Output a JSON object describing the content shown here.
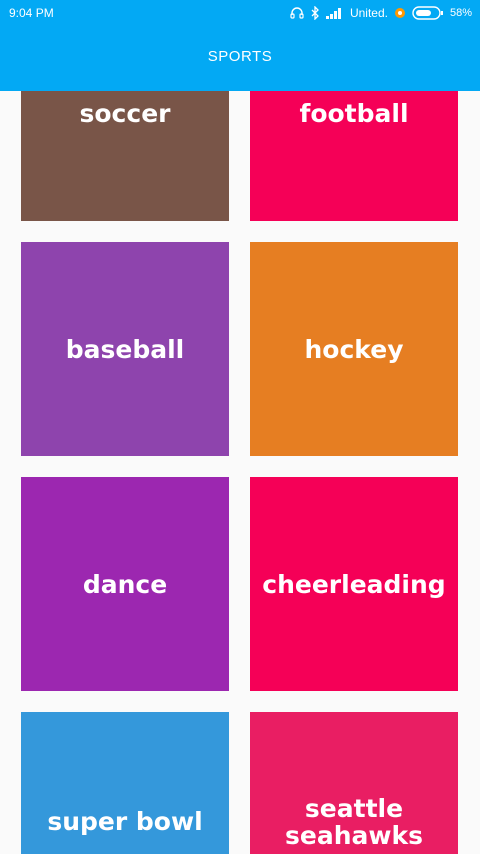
{
  "status_bar": {
    "time": "9:04 PM",
    "carrier": "United.",
    "battery": "58%"
  },
  "header": {
    "title": "SPORTS"
  },
  "tiles": [
    {
      "label": "soccer",
      "color": "#795548"
    },
    {
      "label": "football",
      "color": "#f50057"
    },
    {
      "label": "baseball",
      "color": "#8e44ad"
    },
    {
      "label": "hockey",
      "color": "#e67e22"
    },
    {
      "label": "dance",
      "color": "#9c27b0"
    },
    {
      "label": "cheerleading",
      "color": "#f50057"
    },
    {
      "label": "super bowl",
      "color": "#3498db"
    },
    {
      "label": "seattle seahawks",
      "color": "#e91e63"
    }
  ],
  "colors": {
    "app_bar": "#03a9f4",
    "background": "#fafafa"
  }
}
